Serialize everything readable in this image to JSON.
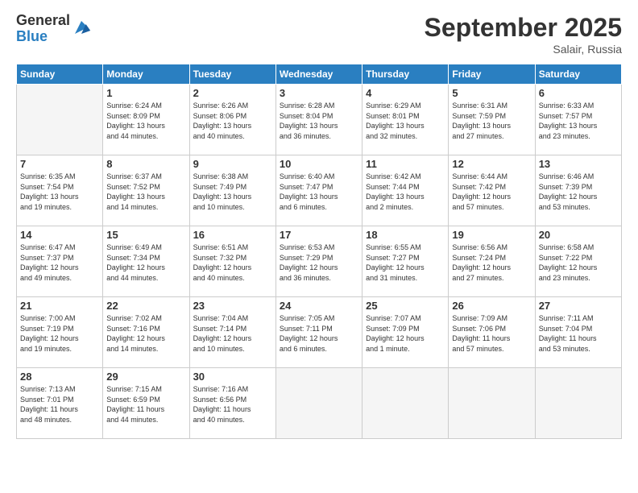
{
  "logo": {
    "general": "General",
    "blue": "Blue"
  },
  "header": {
    "month": "September 2025",
    "location": "Salair, Russia"
  },
  "weekdays": [
    "Sunday",
    "Monday",
    "Tuesday",
    "Wednesday",
    "Thursday",
    "Friday",
    "Saturday"
  ],
  "weeks": [
    [
      {
        "day": "",
        "info": ""
      },
      {
        "day": "1",
        "info": "Sunrise: 6:24 AM\nSunset: 8:09 PM\nDaylight: 13 hours\nand 44 minutes."
      },
      {
        "day": "2",
        "info": "Sunrise: 6:26 AM\nSunset: 8:06 PM\nDaylight: 13 hours\nand 40 minutes."
      },
      {
        "day": "3",
        "info": "Sunrise: 6:28 AM\nSunset: 8:04 PM\nDaylight: 13 hours\nand 36 minutes."
      },
      {
        "day": "4",
        "info": "Sunrise: 6:29 AM\nSunset: 8:01 PM\nDaylight: 13 hours\nand 32 minutes."
      },
      {
        "day": "5",
        "info": "Sunrise: 6:31 AM\nSunset: 7:59 PM\nDaylight: 13 hours\nand 27 minutes."
      },
      {
        "day": "6",
        "info": "Sunrise: 6:33 AM\nSunset: 7:57 PM\nDaylight: 13 hours\nand 23 minutes."
      }
    ],
    [
      {
        "day": "7",
        "info": "Sunrise: 6:35 AM\nSunset: 7:54 PM\nDaylight: 13 hours\nand 19 minutes."
      },
      {
        "day": "8",
        "info": "Sunrise: 6:37 AM\nSunset: 7:52 PM\nDaylight: 13 hours\nand 14 minutes."
      },
      {
        "day": "9",
        "info": "Sunrise: 6:38 AM\nSunset: 7:49 PM\nDaylight: 13 hours\nand 10 minutes."
      },
      {
        "day": "10",
        "info": "Sunrise: 6:40 AM\nSunset: 7:47 PM\nDaylight: 13 hours\nand 6 minutes."
      },
      {
        "day": "11",
        "info": "Sunrise: 6:42 AM\nSunset: 7:44 PM\nDaylight: 13 hours\nand 2 minutes."
      },
      {
        "day": "12",
        "info": "Sunrise: 6:44 AM\nSunset: 7:42 PM\nDaylight: 12 hours\nand 57 minutes."
      },
      {
        "day": "13",
        "info": "Sunrise: 6:46 AM\nSunset: 7:39 PM\nDaylight: 12 hours\nand 53 minutes."
      }
    ],
    [
      {
        "day": "14",
        "info": "Sunrise: 6:47 AM\nSunset: 7:37 PM\nDaylight: 12 hours\nand 49 minutes."
      },
      {
        "day": "15",
        "info": "Sunrise: 6:49 AM\nSunset: 7:34 PM\nDaylight: 12 hours\nand 44 minutes."
      },
      {
        "day": "16",
        "info": "Sunrise: 6:51 AM\nSunset: 7:32 PM\nDaylight: 12 hours\nand 40 minutes."
      },
      {
        "day": "17",
        "info": "Sunrise: 6:53 AM\nSunset: 7:29 PM\nDaylight: 12 hours\nand 36 minutes."
      },
      {
        "day": "18",
        "info": "Sunrise: 6:55 AM\nSunset: 7:27 PM\nDaylight: 12 hours\nand 31 minutes."
      },
      {
        "day": "19",
        "info": "Sunrise: 6:56 AM\nSunset: 7:24 PM\nDaylight: 12 hours\nand 27 minutes."
      },
      {
        "day": "20",
        "info": "Sunrise: 6:58 AM\nSunset: 7:22 PM\nDaylight: 12 hours\nand 23 minutes."
      }
    ],
    [
      {
        "day": "21",
        "info": "Sunrise: 7:00 AM\nSunset: 7:19 PM\nDaylight: 12 hours\nand 19 minutes."
      },
      {
        "day": "22",
        "info": "Sunrise: 7:02 AM\nSunset: 7:16 PM\nDaylight: 12 hours\nand 14 minutes."
      },
      {
        "day": "23",
        "info": "Sunrise: 7:04 AM\nSunset: 7:14 PM\nDaylight: 12 hours\nand 10 minutes."
      },
      {
        "day": "24",
        "info": "Sunrise: 7:05 AM\nSunset: 7:11 PM\nDaylight: 12 hours\nand 6 minutes."
      },
      {
        "day": "25",
        "info": "Sunrise: 7:07 AM\nSunset: 7:09 PM\nDaylight: 12 hours\nand 1 minute."
      },
      {
        "day": "26",
        "info": "Sunrise: 7:09 AM\nSunset: 7:06 PM\nDaylight: 11 hours\nand 57 minutes."
      },
      {
        "day": "27",
        "info": "Sunrise: 7:11 AM\nSunset: 7:04 PM\nDaylight: 11 hours\nand 53 minutes."
      }
    ],
    [
      {
        "day": "28",
        "info": "Sunrise: 7:13 AM\nSunset: 7:01 PM\nDaylight: 11 hours\nand 48 minutes."
      },
      {
        "day": "29",
        "info": "Sunrise: 7:15 AM\nSunset: 6:59 PM\nDaylight: 11 hours\nand 44 minutes."
      },
      {
        "day": "30",
        "info": "Sunrise: 7:16 AM\nSunset: 6:56 PM\nDaylight: 11 hours\nand 40 minutes."
      },
      {
        "day": "",
        "info": ""
      },
      {
        "day": "",
        "info": ""
      },
      {
        "day": "",
        "info": ""
      },
      {
        "day": "",
        "info": ""
      }
    ]
  ]
}
